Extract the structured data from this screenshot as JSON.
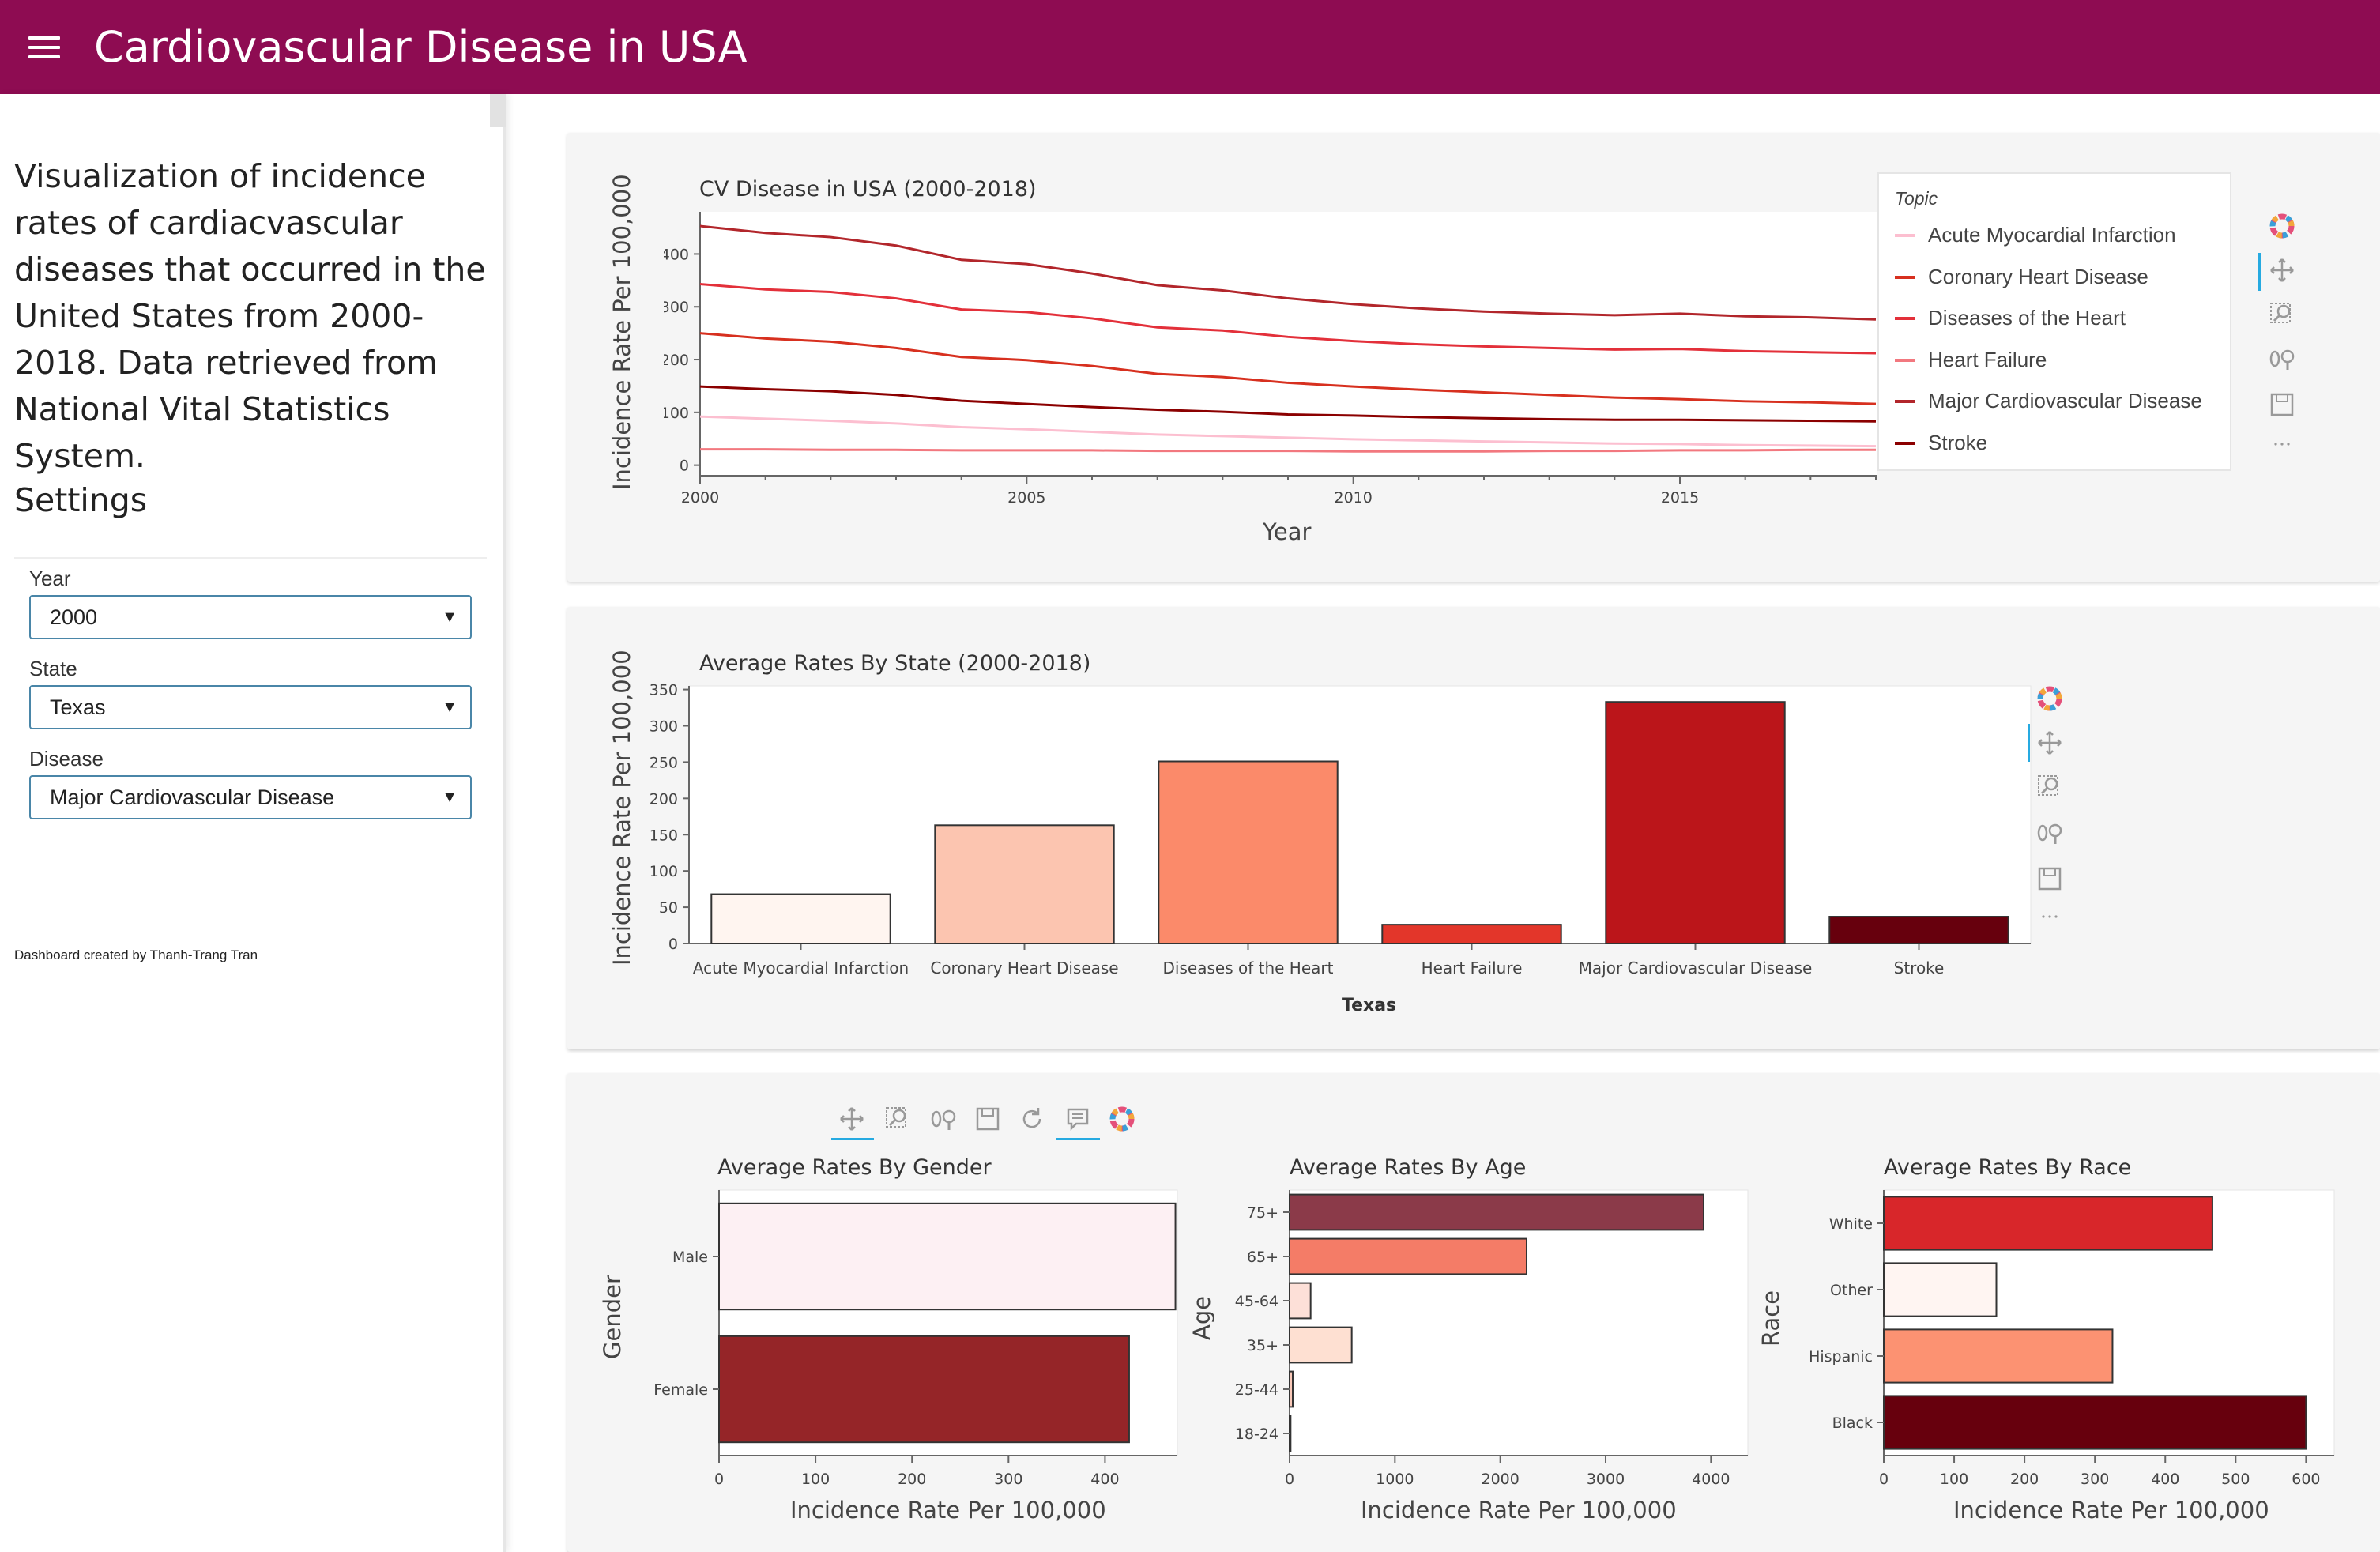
{
  "app": {
    "title": "Cardiovascular Disease in USA"
  },
  "sidebar": {
    "intro": "Visualization of incidence rates of cardiacvascular diseases that occurred in the United States from 2000-2018. Data retrieved from National Vital Statistics System.",
    "settings_heading": "Settings",
    "fields": [
      {
        "label": "Year",
        "value": "2000"
      },
      {
        "label": "State",
        "value": "Texas"
      },
      {
        "label": "Disease",
        "value": "Major Cardiovascular Disease"
      }
    ],
    "credit": "Dashboard created by Thanh-Trang Tran"
  },
  "toolbar_icons": [
    "bokeh-logo-icon",
    "pan-icon",
    "box-zoom-icon",
    "wheel-zoom-icon",
    "save-icon",
    "more-icon",
    "reset-icon",
    "hover-icon"
  ],
  "colors": {
    "header": "#8e0c52",
    "acute": "#fcbfd0",
    "coronary": "#d7301f",
    "diseases_heart": "#e3303a",
    "heart_failure": "#f2787f",
    "major_cv": "#b2262b",
    "stroke": "#8b0000"
  },
  "chart_data": [
    {
      "type": "line",
      "title": "CV Disease in USA (2000-2018)",
      "xlabel": "Year",
      "ylabel": "Incidence Rate Per 100,000",
      "xlim": [
        2000,
        2018
      ],
      "ylim": [
        -20,
        480
      ],
      "x_ticks": [
        2000,
        2005,
        2010,
        2015
      ],
      "y_ticks": [
        0,
        100,
        200,
        300,
        400
      ],
      "legend_title": "Topic",
      "legend_position": "top-right",
      "x": [
        2000,
        2001,
        2002,
        2003,
        2004,
        2005,
        2006,
        2007,
        2008,
        2009,
        2010,
        2011,
        2012,
        2013,
        2014,
        2015,
        2016,
        2017,
        2018
      ],
      "series": [
        {
          "name": "Acute Myocardial Infarction",
          "color": "#fcbfd0",
          "values": [
            92,
            88,
            84,
            79,
            72,
            68,
            63,
            58,
            55,
            52,
            49,
            47,
            45,
            43,
            41,
            40,
            38,
            37,
            36
          ]
        },
        {
          "name": "Coronary Heart Disease",
          "color": "#d7301f",
          "values": [
            250,
            240,
            234,
            222,
            205,
            199,
            188,
            173,
            167,
            156,
            149,
            143,
            138,
            133,
            128,
            125,
            121,
            119,
            116
          ]
        },
        {
          "name": "Diseases of the Heart",
          "color": "#e3303a",
          "values": [
            343,
            333,
            328,
            316,
            295,
            290,
            278,
            261,
            255,
            243,
            235,
            229,
            225,
            222,
            219,
            220,
            216,
            214,
            212
          ]
        },
        {
          "name": "Heart Failure",
          "color": "#f2787f",
          "values": [
            30,
            30,
            29,
            29,
            28,
            28,
            28,
            27,
            27,
            27,
            26,
            26,
            26,
            27,
            27,
            28,
            28,
            29,
            29
          ]
        },
        {
          "name": "Major Cardiovascular Disease",
          "color": "#b2262b",
          "values": [
            453,
            440,
            432,
            416,
            389,
            381,
            363,
            341,
            331,
            316,
            305,
            297,
            291,
            287,
            284,
            287,
            282,
            280,
            276
          ]
        },
        {
          "name": "Stroke",
          "color": "#8b0000",
          "values": [
            149,
            144,
            140,
            133,
            122,
            116,
            110,
            105,
            101,
            96,
            94,
            91,
            89,
            87,
            86,
            86,
            85,
            84,
            83
          ]
        }
      ]
    },
    {
      "type": "bar",
      "title": "Average Rates By State (2000-2018)",
      "xlabel": "Texas",
      "ylabel": "Incidence Rate Per 100,000",
      "ylim": [
        0,
        355
      ],
      "y_ticks": [
        0,
        50,
        100,
        150,
        200,
        250,
        300,
        350
      ],
      "categories": [
        "Acute Myocardial Infarction",
        "Coronary Heart Disease",
        "Diseases of the Heart",
        "Heart Failure",
        "Major Cardiovascular Disease",
        "Stroke"
      ],
      "values": [
        68,
        163,
        251,
        26,
        333,
        37
      ],
      "colors": [
        "#fff5f0",
        "#fcc5b0",
        "#fb8a6a",
        "#e3362a",
        "#bb151a",
        "#67000d"
      ]
    },
    {
      "type": "bar",
      "orientation": "horizontal",
      "title": "Average Rates By Gender",
      "xlabel": "Incidence Rate Per 100,000",
      "ylabel": "Gender",
      "xlim": [
        0,
        475
      ],
      "x_ticks": [
        0,
        100,
        200,
        300,
        400
      ],
      "categories": [
        "Male",
        "Female"
      ],
      "values": [
        473,
        425
      ],
      "colors": [
        "#fdf0f3",
        "#952528"
      ]
    },
    {
      "type": "bar",
      "orientation": "horizontal",
      "title": "Average Rates By Age",
      "xlabel": "Incidence Rate Per 100,000",
      "ylabel": "Age",
      "xlim": [
        0,
        4350
      ],
      "x_ticks": [
        0,
        1000,
        2000,
        3000,
        4000
      ],
      "categories": [
        "75+",
        "65+",
        "45-64",
        "35+",
        "25-44",
        "18-24"
      ],
      "values": [
        3930,
        2250,
        200,
        590,
        30,
        10
      ],
      "colors": [
        "#8b3a49",
        "#f47c67",
        "#fde0d8",
        "#fee0d2",
        "#f8c8b8",
        "#fff5f0"
      ]
    },
    {
      "type": "bar",
      "orientation": "horizontal",
      "title": "Average Rates By Race",
      "xlabel": "Incidence Rate Per 100,000",
      "ylabel": "Race",
      "xlim": [
        0,
        640
      ],
      "x_ticks": [
        0,
        100,
        200,
        300,
        400,
        500,
        600
      ],
      "categories": [
        "White",
        "Other",
        "Hispanic",
        "Black"
      ],
      "values": [
        467,
        160,
        325,
        600
      ],
      "colors": [
        "#d8262a",
        "#fff5f2",
        "#fc9272",
        "#67000d"
      ]
    }
  ]
}
